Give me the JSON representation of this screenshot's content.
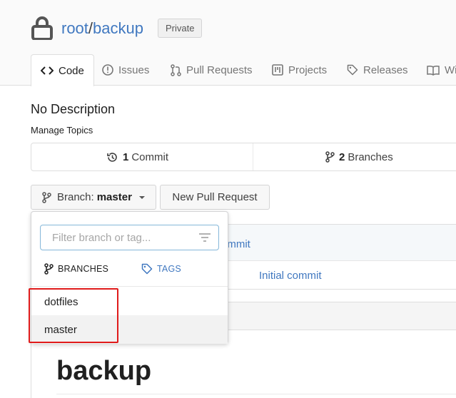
{
  "repo": {
    "owner": "root",
    "separator": "/",
    "name": "backup",
    "visibility": "Private"
  },
  "tabs": [
    {
      "label": "Code",
      "icon": "code-icon",
      "active": true
    },
    {
      "label": "Issues",
      "icon": "issue-icon"
    },
    {
      "label": "Pull Requests",
      "icon": "pull-request-icon"
    },
    {
      "label": "Projects",
      "icon": "project-icon"
    },
    {
      "label": "Releases",
      "icon": "tag-icon"
    },
    {
      "label": "Wi",
      "icon": "book-icon"
    }
  ],
  "description": "No Description",
  "manage_topics": "Manage Topics",
  "stats": {
    "commits_count": "1",
    "commits_label": "Commit",
    "branches_count": "2",
    "branches_label": "Branches"
  },
  "branch_button": {
    "prefix": "Branch:",
    "current": "master"
  },
  "new_pull_request": "New Pull Request",
  "file_table": {
    "head_commit_partial": "ommit",
    "row_commit": "Initial commit"
  },
  "readme": {
    "title": "backup"
  },
  "dropdown": {
    "placeholder": "Filter branch or tag...",
    "tab_branches": "BRANCHES",
    "tab_tags": "TAGS",
    "items": [
      "dotfiles",
      "master"
    ],
    "selected": "master"
  },
  "colors": {
    "link": "#4078c0",
    "highlight_box": "#e01b1b",
    "filter_border": "#85b7d9"
  }
}
